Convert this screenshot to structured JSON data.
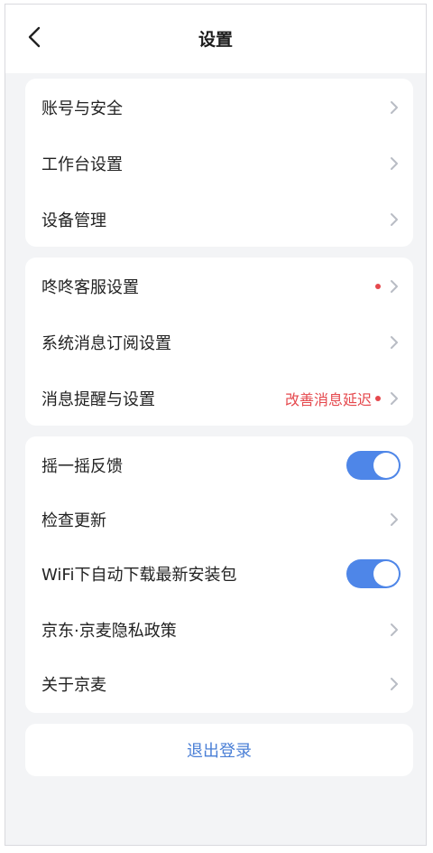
{
  "header": {
    "title": "设置",
    "back_icon": "chevron-left-icon"
  },
  "colors": {
    "accent_blue": "#4e86e8",
    "alert_red": "#e5484d",
    "logout_text": "#4a7fd6",
    "chevron": "#b8bcc4"
  },
  "group1": {
    "items": [
      {
        "label": "账号与安全"
      },
      {
        "label": "工作台设置"
      },
      {
        "label": "设备管理"
      }
    ]
  },
  "group2": {
    "items": [
      {
        "label": "咚咚客服设置",
        "has_red_dot": true
      },
      {
        "label": "系统消息订阅设置"
      },
      {
        "label": "消息提醒与设置",
        "hint": "改善消息延迟",
        "has_red_dot": true
      }
    ]
  },
  "group3": {
    "items": [
      {
        "label": "摇一摇反馈",
        "toggle": "on"
      },
      {
        "label": "检查更新"
      },
      {
        "label": "WiFi下自动下载最新安装包",
        "toggle": "on"
      },
      {
        "label": "京东·京麦隐私政策"
      },
      {
        "label": "关于京麦"
      }
    ]
  },
  "logout": {
    "label": "退出登录"
  }
}
